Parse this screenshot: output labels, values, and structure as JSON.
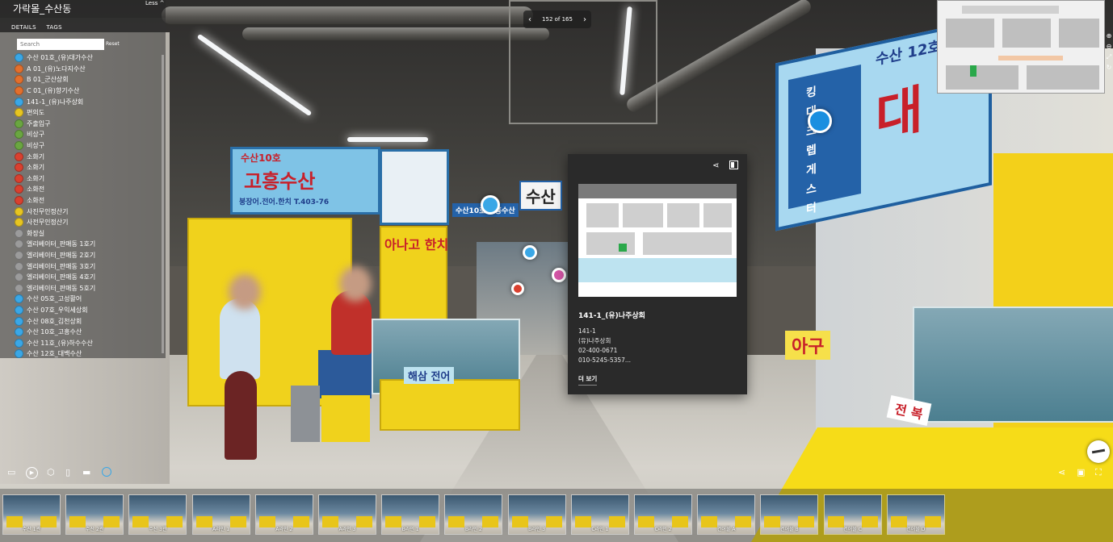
{
  "location_title": "가락몰_수산동",
  "less_label": "Less ^",
  "tabs": [
    "DETAILS",
    "TAGS"
  ],
  "search": {
    "placeholder": "Search",
    "reset_label": "Reset"
  },
  "list_items": [
    {
      "label": "수산 01호_(유)대가수산",
      "color": "#3aa7e6"
    },
    {
      "label": "A 01_(유)노다지수산",
      "color": "#e36f2c"
    },
    {
      "label": "B 01_군산상회",
      "color": "#e36f2c"
    },
    {
      "label": "C 01_(유)향기수산",
      "color": "#e36f2c"
    },
    {
      "label": "141-1_(유)나주상회",
      "color": "#3aa7e6"
    },
    {
      "label": "편의도",
      "color": "#e7c520"
    },
    {
      "label": "주출입구",
      "color": "#6aa640"
    },
    {
      "label": "비상구",
      "color": "#6aa640"
    },
    {
      "label": "비상구",
      "color": "#6aa640"
    },
    {
      "label": "소화기",
      "color": "#d9402f"
    },
    {
      "label": "소화기",
      "color": "#d9402f"
    },
    {
      "label": "소화기",
      "color": "#d9402f"
    },
    {
      "label": "소화전",
      "color": "#d9402f"
    },
    {
      "label": "소화전",
      "color": "#d9402f"
    },
    {
      "label": "사진무인정산기",
      "color": "#e7c520"
    },
    {
      "label": "사전무인정산기",
      "color": "#e7c520"
    },
    {
      "label": "화장실",
      "color": "#9b9b9b"
    },
    {
      "label": "엘리베이터_판매동 1호기",
      "color": "#9b9b9b"
    },
    {
      "label": "엘리베이터_판매동 2호기",
      "color": "#9b9b9b"
    },
    {
      "label": "엘리베이터_판매동 3호기",
      "color": "#9b9b9b"
    },
    {
      "label": "엘리베이터_판매동 4호기",
      "color": "#9b9b9b"
    },
    {
      "label": "엘리베이터_판매동 5호기",
      "color": "#9b9b9b"
    },
    {
      "label": "수산 05호_고성활어",
      "color": "#3aa7e6"
    },
    {
      "label": "수산 07호_우익세상회",
      "color": "#3aa7e6"
    },
    {
      "label": "수산 08호_김천상회",
      "color": "#3aa7e6"
    },
    {
      "label": "수산 10호_고흥수산",
      "color": "#3aa7e6"
    },
    {
      "label": "수산 11호_(유)하수수산",
      "color": "#3aa7e6"
    },
    {
      "label": "수산 12호_대백수산",
      "color": "#3aa7e6"
    }
  ],
  "counter": {
    "text": "152 of 165",
    "prev": "‹",
    "next": "›"
  },
  "card": {
    "title": "141-1_(유)나주상회",
    "lines": [
      "141-1",
      "(유)나주상회",
      "02-400-0671",
      "010-5245-5357..."
    ],
    "more_label": "더 보기"
  },
  "scene_texts": {
    "sign_left_name": "고흥수산",
    "sign_left_no": "수산10호",
    "sign_left_sub": "붕장어.전어.한치 T.403-76",
    "sign_mid": "수산",
    "sign_right_no": "수산 12호",
    "sign_right_big": "대",
    "sign_right_vert": "킹 대 크 렙 게 스 터",
    "sign_anago": "아나고 한치",
    "sign_agu": "아구",
    "sign_jeonbok": "전 복",
    "sign_haesam": "해삼 전어",
    "sign_board_small": "수산10호 고흥수산"
  },
  "toolbar_left": [
    "floorplan-icon",
    "play-icon",
    "dollhouse-icon",
    "measure-icon",
    "ruler-icon",
    "tag-icon"
  ],
  "toolbar_right": [
    "share-icon",
    "vr-icon",
    "fullscreen-icon"
  ],
  "thumbnails": [
    "수산 1관",
    "수산 2관",
    "수산 3관",
    "A라인 1",
    "A라인 2",
    "A라인 3",
    "B라인 1",
    "B라인 2",
    "B라인 3",
    "C라인 1",
    "C라인 2",
    "건어물 A",
    "건어물 B",
    "건어물 C",
    "건어물 D"
  ],
  "colors": {
    "panel_bg": "rgba(50,50,50,0.55)",
    "card_bg": "#2a2a2a",
    "accent_blue": "#3aa7e6"
  }
}
